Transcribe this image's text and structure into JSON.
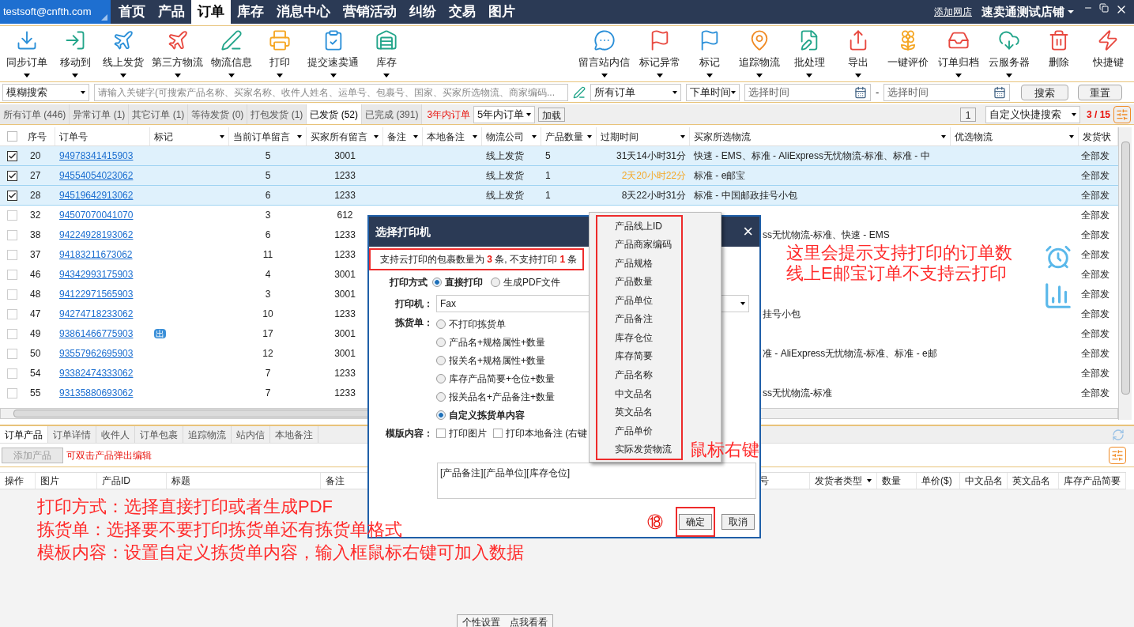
{
  "account": "testsoft@cnfth.com",
  "nav_tabs": [
    {
      "label": "首页",
      "selected": false
    },
    {
      "label": "产品",
      "selected": false
    },
    {
      "label": "订单",
      "selected": true
    },
    {
      "label": "库存",
      "selected": false
    },
    {
      "label": "消息中心",
      "selected": false
    },
    {
      "label": "营销活动",
      "selected": false
    },
    {
      "label": "纠纷",
      "selected": false
    },
    {
      "label": "交易",
      "selected": false
    },
    {
      "label": "图片",
      "selected": false
    }
  ],
  "add_store": "添加网店",
  "store": "速卖通测试店铺",
  "toolbar_left": [
    {
      "label": "同步订单",
      "has_menu": true
    },
    {
      "label": "移动到",
      "has_menu": true
    },
    {
      "label": "线上发货",
      "has_menu": true
    },
    {
      "label": "第三方物流",
      "has_menu": true
    },
    {
      "label": "物流信息",
      "has_menu": true
    },
    {
      "label": "打印",
      "has_menu": true
    },
    {
      "label": "提交速卖通",
      "has_menu": true
    },
    {
      "label": "库存",
      "has_menu": true
    }
  ],
  "toolbar_right": [
    {
      "label": "留言站内信",
      "has_menu": true
    },
    {
      "label": "标记异常",
      "has_menu": true
    },
    {
      "label": "标记",
      "has_menu": true
    },
    {
      "label": "追踪物流",
      "has_menu": true
    },
    {
      "label": "批处理",
      "has_menu": true
    },
    {
      "label": "导出",
      "has_menu": true
    },
    {
      "label": "一键评价",
      "has_menu": false
    },
    {
      "label": "订单归档",
      "has_menu": true
    },
    {
      "label": "云服务器",
      "has_menu": true
    },
    {
      "label": "删除",
      "has_menu": false
    },
    {
      "label": "快捷键",
      "has_menu": false
    }
  ],
  "search": {
    "mode": "模糊搜索",
    "placeholder": "请输入关键字(可搜索产品名称、买家名称、收件人姓名、运单号、包裹号、国家、买家所选物流、商家编码...",
    "order_filter": "所有订单",
    "time_type": "下单时间",
    "from_placeholder": "选择时间",
    "separator": "-",
    "to_placeholder": "选择时间",
    "search_button": "搜索",
    "reset_button": "重置"
  },
  "status_tabs": [
    {
      "label": "所有订单 (446)",
      "selected": false
    },
    {
      "label": "异常订单 (1)",
      "selected": false
    },
    {
      "label": "其它订单 (1)",
      "selected": false
    },
    {
      "label": "等待发货 (0)",
      "selected": false
    },
    {
      "label": "打包发货 (1)",
      "selected": false
    },
    {
      "label": "已发货 (52)",
      "selected": true
    },
    {
      "label": "已完成 (391)",
      "selected": false
    }
  ],
  "range_label": "3年内订单",
  "range_select": "5年内订单",
  "load_button": "加载",
  "page_box": "1",
  "quick_search": "自定义快捷搜索",
  "page_count": "3 / 15",
  "table": {
    "select_all": false,
    "columns": [
      {
        "label": "序号",
        "filter": false
      },
      {
        "label": "订单号",
        "filter": false
      },
      {
        "label": "标记",
        "filter": true
      },
      {
        "label": "当前订单留言",
        "filter": true
      },
      {
        "label": "买家所有留言",
        "filter": true
      },
      {
        "label": "备注",
        "filter": true
      },
      {
        "label": "本地备注",
        "filter": true
      },
      {
        "label": "物流公司",
        "filter": true
      },
      {
        "label": "产品数量",
        "filter": true
      },
      {
        "label": "过期时间",
        "filter": true
      },
      {
        "label": "买家所选物流",
        "filter": true
      },
      {
        "label": "优选物流",
        "filter": true
      },
      {
        "label": "发货状",
        "filter": false
      }
    ],
    "rows": [
      {
        "checked": true,
        "no": "20",
        "order": "94978341415903",
        "current_msg": "5",
        "buyer_msg": "3001",
        "carrier": "线上发货",
        "qty": "5",
        "expiry": "31天14小时31分",
        "expiry_warning": false,
        "buyer_logistics": "快速 - EMS、标准 - AliExpress无忧物流-标准、标准 - 中",
        "status": "全部发"
      },
      {
        "checked": true,
        "no": "27",
        "order": "94554054023062",
        "current_msg": "5",
        "buyer_msg": "1233",
        "carrier": "线上发货",
        "qty": "1",
        "expiry": "2天20小时22分",
        "expiry_warning": true,
        "buyer_logistics": "标准 - e邮宝",
        "status": "全部发"
      },
      {
        "checked": true,
        "no": "28",
        "order": "94519642913062",
        "current_msg": "6",
        "buyer_msg": "1233",
        "carrier": "线上发货",
        "qty": "1",
        "expiry": "8天22小时31分",
        "expiry_warning": false,
        "buyer_logistics": "标准 - 中国邮政挂号小包",
        "status": "全部发"
      },
      {
        "checked": false,
        "no": "32",
        "order": "94507070041070",
        "current_msg": "3",
        "buyer_msg": "612",
        "status": "全部发"
      },
      {
        "checked": false,
        "no": "38",
        "order": "94224928193062",
        "current_msg": "6",
        "buyer_msg": "1233",
        "buyer_logistics_tail": "ss无忧物流-标准、快速 - EMS",
        "status": "全部发"
      },
      {
        "checked": false,
        "no": "37",
        "order": "94183211673062",
        "current_msg": "11",
        "buyer_msg": "1233",
        "status": "全部发"
      },
      {
        "checked": false,
        "no": "46",
        "order": "94342993175903",
        "current_msg": "4",
        "buyer_msg": "3001",
        "status": "全部发"
      },
      {
        "checked": false,
        "no": "48",
        "order": "94122971565903",
        "current_msg": "3",
        "buyer_msg": "3001",
        "status": "全部发"
      },
      {
        "checked": false,
        "no": "47",
        "order": "94274718233062",
        "current_msg": "10",
        "buyer_msg": "1233",
        "buyer_logistics_tail": "挂号小包",
        "status": "全部发"
      },
      {
        "checked": false,
        "no": "49",
        "order": "93861466775903",
        "mark": "出",
        "current_msg": "17",
        "buyer_msg": "3001",
        "status": "全部发"
      },
      {
        "checked": false,
        "no": "50",
        "order": "93557962695903",
        "current_msg": "12",
        "buyer_msg": "3001",
        "buyer_logistics_tail": "准 - AliExpress无忧物流-标准、标准 - e邮",
        "status": "全部发"
      },
      {
        "checked": false,
        "no": "54",
        "order": "93382474333062",
        "current_msg": "7",
        "buyer_msg": "1233",
        "status": "全部发"
      },
      {
        "checked": false,
        "no": "55",
        "order": "93135880693062",
        "current_msg": "7",
        "buyer_msg": "1233",
        "buyer_logistics_tail": "ss无忧物流-标准",
        "status": "全部发"
      }
    ]
  },
  "detail_tabs": [
    {
      "label": "订单产品",
      "selected": true
    },
    {
      "label": "订单详情",
      "selected": false
    },
    {
      "label": "收件人",
      "selected": false
    },
    {
      "label": "订单包裹",
      "selected": false
    },
    {
      "label": "追踪物流",
      "selected": false
    },
    {
      "label": "站内信",
      "selected": false
    },
    {
      "label": "本地备注",
      "selected": false
    }
  ],
  "add_product": {
    "label": "添加产品",
    "disabled": true
  },
  "detail_hint": "可双击产品弹出编辑",
  "detail_columns_left": [
    "操作",
    "图片",
    "产品ID",
    "标题",
    "备注"
  ],
  "detail_columns_right": [
    {
      "label": "号",
      "filter": false
    },
    {
      "label": "发货者类型",
      "filter": true
    },
    {
      "label": "数量",
      "filter": false
    },
    {
      "label": "单价($)",
      "filter": false
    },
    {
      "label": "中文品名",
      "filter": false
    },
    {
      "label": "英文品名",
      "filter": false
    },
    {
      "label": "库存产品简要",
      "filter": false
    }
  ],
  "settings_button": "个性设置　点我看看",
  "dialog": {
    "title": "选择打印机",
    "close": "×",
    "message": "支持云打印的包裹数量为 **3** 条, 不支持打印 **1** 条",
    "print_mode_label": "打印方式",
    "print_modes": [
      {
        "label": "直接打印",
        "selected": true
      },
      {
        "label": "生成PDF文件",
        "selected": false
      }
    ],
    "printer_label": "打印机：",
    "printer": "Fax",
    "picklist_label": "拣货单：",
    "picklist_options": [
      {
        "label": "不打印拣货单",
        "selected": false
      },
      {
        "label": "产品名+规格属性+数量",
        "selected": false
      },
      {
        "label": "报关名+规格属性+数量",
        "selected": false
      },
      {
        "label": "库存产品简要+仓位+数量",
        "selected": false
      },
      {
        "label": "报关品名+产品备注+数量",
        "selected": false
      },
      {
        "label": "自定义拣货单内容",
        "selected": true
      }
    ],
    "template_label": "模版内容：",
    "template_options": [
      {
        "label": "打印图片",
        "checked": false
      },
      {
        "label": "打印本地备注 (右键",
        "checked": false
      }
    ],
    "template_text": "[产品备注][产品单位][库存仓位]",
    "ok": "确定",
    "cancel": "取消"
  },
  "context_menu": [
    "产品线上ID",
    "产品商家编码",
    "产品规格",
    "产品数量",
    "产品单位",
    "产品备注",
    "库存仓位",
    "库存简要",
    "产品名称",
    "中文品名",
    "英文品名",
    "产品单价",
    "实际发货物流"
  ],
  "annotations": {
    "top": [
      "这里会提示支持打印的订单数",
      "线上E邮宝订单不支持云打印"
    ],
    "right_click": "鼠标右键",
    "step": "⑱",
    "bottom": [
      "打印方式：选择直接打印或者生成PDF",
      "拣货单：选择要不要打印拣货单还有拣货单格式",
      "模板内容：设置自定义拣货单内容，输入框鼠标右键可加入数据"
    ]
  }
}
